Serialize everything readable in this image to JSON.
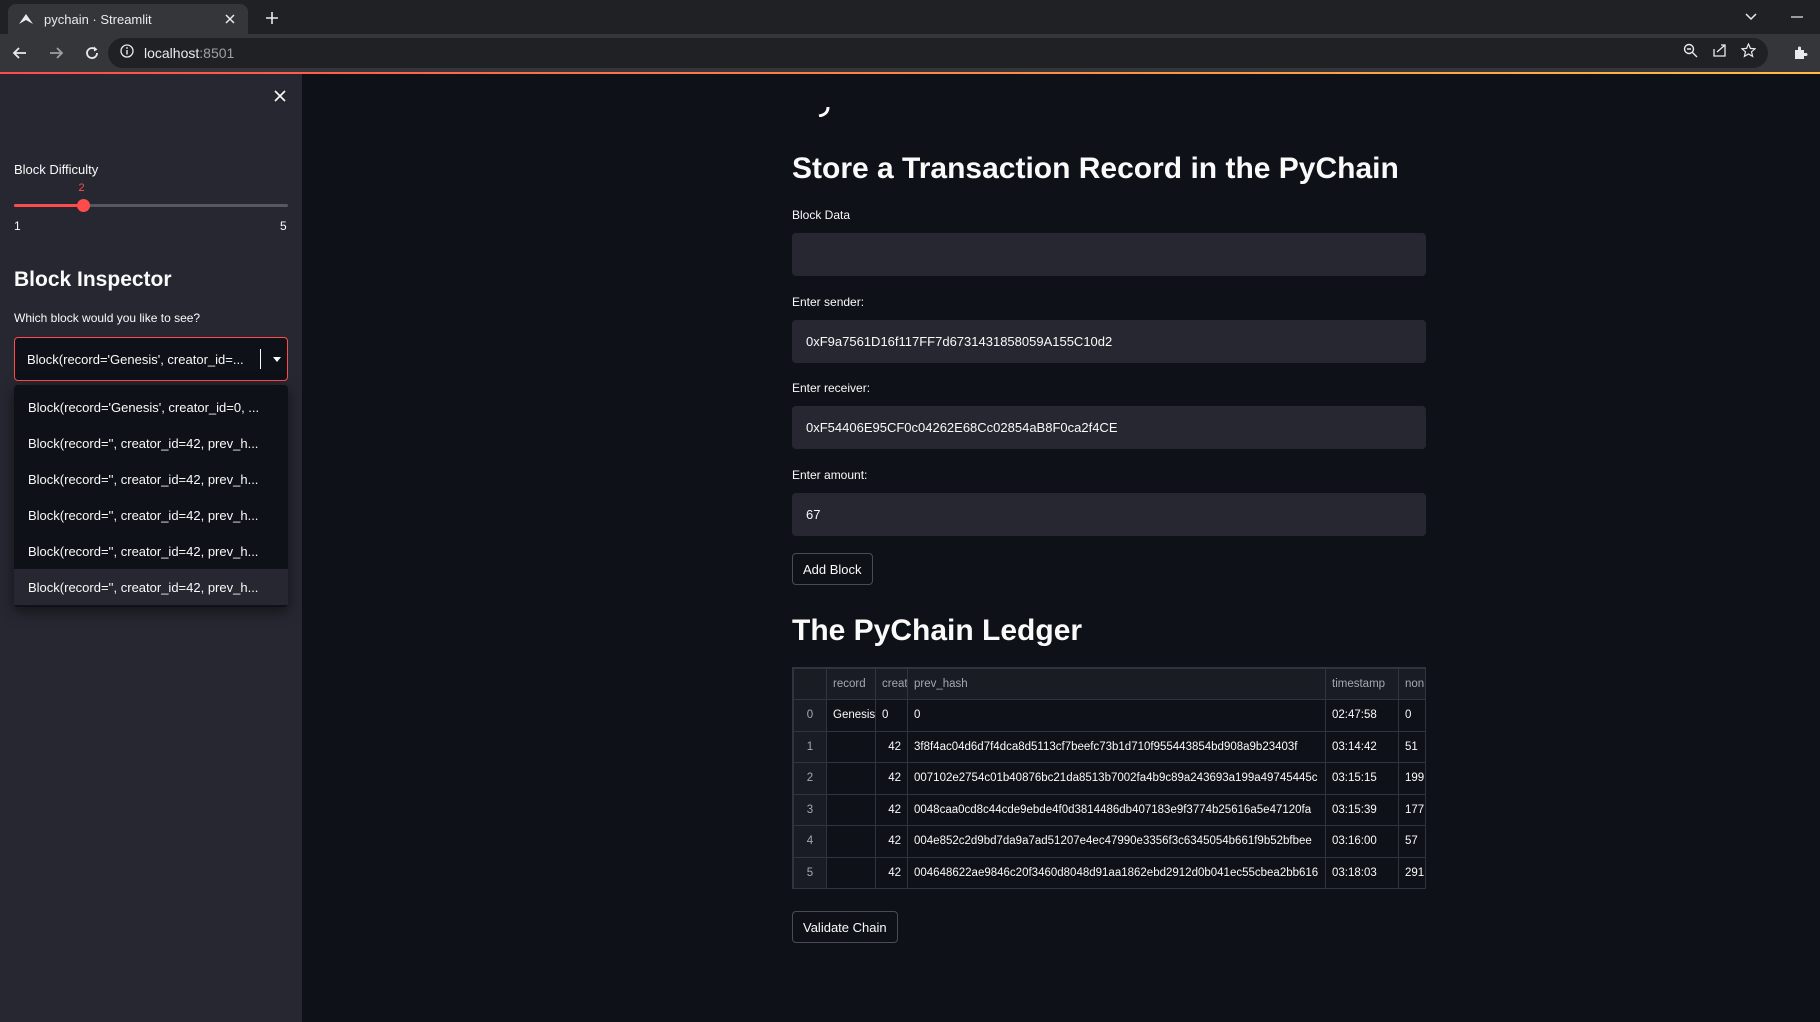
{
  "browser": {
    "tab_title": "pychain · Streamlit",
    "url_host": "localhost",
    "url_port": ":8501"
  },
  "sidebar": {
    "difficulty_label": "Block Difficulty",
    "difficulty_value": "2",
    "difficulty_level": 2,
    "difficulty_min": "1",
    "difficulty_max": "5",
    "inspector_heading": "Block Inspector",
    "inspector_question": "Which block would you like to see?",
    "selected_value": "Block(record='Genesis', creator_id=...",
    "options": [
      "Block(record='Genesis', creator_id=0, ...",
      "Block(record='', creator_id=42, prev_h...",
      "Block(record='', creator_id=42, prev_h...",
      "Block(record='', creator_id=42, prev_h...",
      "Block(record='', creator_id=42, prev_h...",
      "Block(record='', creator_id=42, prev_h..."
    ]
  },
  "form": {
    "title": "Store a Transaction Record in the PyChain",
    "block_data_label": "Block Data",
    "block_data_value": "",
    "sender_label": "Enter sender:",
    "sender_value": "0xF9a7561D16f117FF7d6731431858059A155C10d2",
    "receiver_label": "Enter receiver:",
    "receiver_value": "0xF54406E95CF0c04262E68Cc02854aB8F0ca2f4CE",
    "amount_label": "Enter amount:",
    "amount_value": "67",
    "add_block_label": "Add Block"
  },
  "ledger": {
    "title": "The PyChain Ledger",
    "columns": [
      "",
      "record",
      "creat",
      "prev_hash",
      "timestamp",
      "non"
    ],
    "rows": [
      {
        "idx": "0",
        "record": "Genesis",
        "creator": "0",
        "prev_hash": "0",
        "timestamp": "02:47:58",
        "nonce": "0"
      },
      {
        "idx": "1",
        "record": "",
        "creator": "42",
        "prev_hash": "3f8f4ac04d6d7f4dca8d5113cf7beefc73b1d710f955443854bd908a9b23403f",
        "timestamp": "03:14:42",
        "nonce": "51"
      },
      {
        "idx": "2",
        "record": "",
        "creator": "42",
        "prev_hash": "007102e2754c01b40876bc21da8513b7002fa4b9c89a243693a199a49745445c",
        "timestamp": "03:15:15",
        "nonce": "199"
      },
      {
        "idx": "3",
        "record": "",
        "creator": "42",
        "prev_hash": "0048caa0cd8c44cde9ebde4f0d3814486db407183e9f3774b25616a5e47120fa",
        "timestamp": "03:15:39",
        "nonce": "177"
      },
      {
        "idx": "4",
        "record": "",
        "creator": "42",
        "prev_hash": "004e852c2d9bd7da9a7ad51207e4ec47990e3356f3c6345054b661f9b52bfbee",
        "timestamp": "03:16:00",
        "nonce": "57"
      },
      {
        "idx": "5",
        "record": "",
        "creator": "42",
        "prev_hash": "004648622ae9846c20f3460d8048d91aa1862ebd2912d0b041ec55cbea2bb616",
        "timestamp": "03:18:03",
        "nonce": "291"
      }
    ],
    "validate_label": "Validate Chain"
  },
  "colors": {
    "accent": "#ff4b4b",
    "background": "#0e1117",
    "sidebar": "#262730"
  }
}
